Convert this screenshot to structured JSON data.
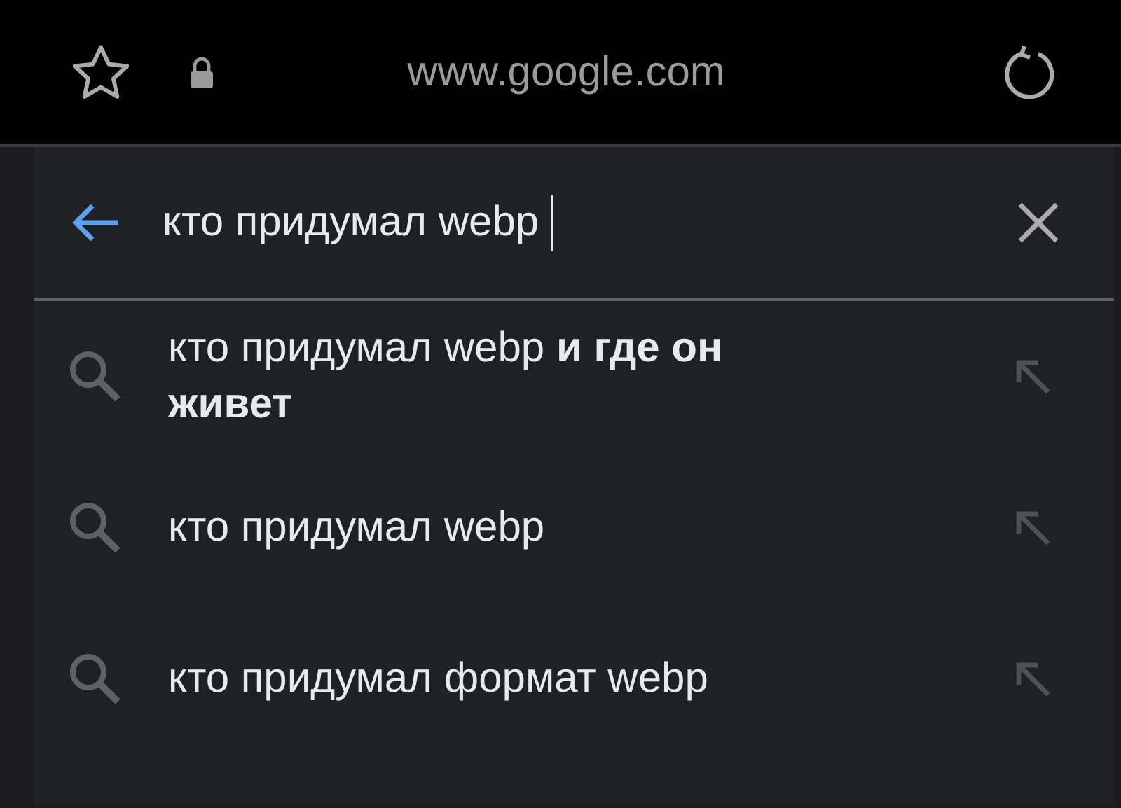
{
  "address_bar": {
    "url": "www.google.com",
    "secure": true
  },
  "search": {
    "value": "кто придумал webp"
  },
  "suggestions": [
    {
      "text": "кто придумал webp **и где он живет**"
    },
    {
      "text": "кто придумал webp"
    },
    {
      "text": "кто придумал формат webp"
    }
  ]
}
